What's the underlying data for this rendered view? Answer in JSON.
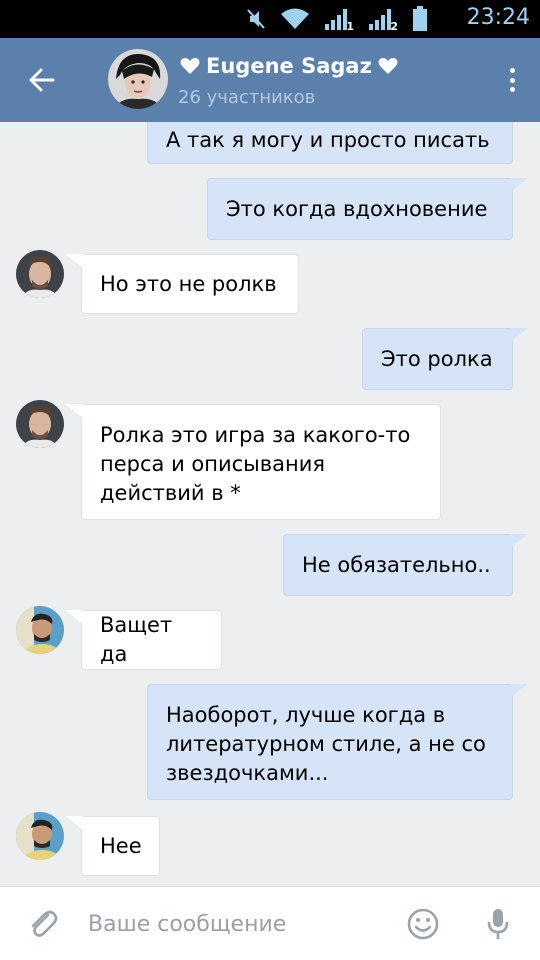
{
  "status_bar": {
    "time": "23:24",
    "sim1_label": "1",
    "sim2_label": "2"
  },
  "header": {
    "title": "Eugene Sagaz",
    "subtitle": "26 участников"
  },
  "messages": [
    {
      "direction": "out",
      "text": "А так я могу и просто писать"
    },
    {
      "direction": "out",
      "text": "Это когда вдохновение"
    },
    {
      "direction": "in",
      "sender": "user-a",
      "text": "Но это не ролкв"
    },
    {
      "direction": "out",
      "text": "Это ролка"
    },
    {
      "direction": "in",
      "sender": "user-a",
      "lines": [
        "Ролка это игра за какого-то",
        "перса и описывания",
        "действий в *"
      ]
    },
    {
      "direction": "out",
      "text": "Не обязательно.."
    },
    {
      "direction": "in",
      "sender": "user-b",
      "text": "Ващет да"
    },
    {
      "direction": "out",
      "lines": [
        "Наоборот, лучше когда в",
        "литературном стиле, а не со",
        "звездочками..."
      ]
    },
    {
      "direction": "in",
      "sender": "user-b",
      "text": "Нее"
    }
  ],
  "composer": {
    "placeholder": "Ваше сообщение"
  },
  "colors": {
    "header_bg": "#5b80ab",
    "outgoing_bubble": "#d5e5f7",
    "incoming_bubble": "#ffffff",
    "chat_bg": "#edeef0",
    "status_icons": "#9ed2ef"
  }
}
